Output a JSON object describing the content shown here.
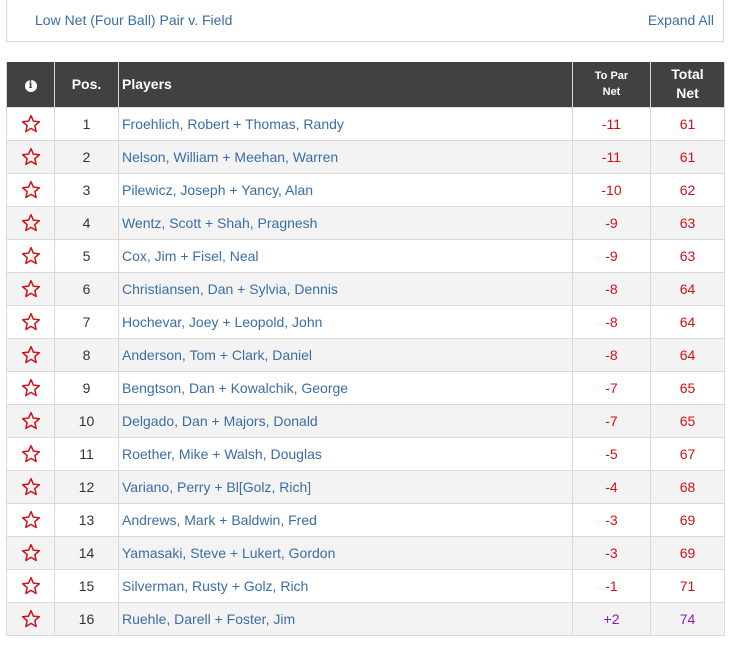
{
  "header": {
    "title": "Low Net (Four Ball) Pair v. Field",
    "expand_label": "Expand All"
  },
  "table": {
    "columns": {
      "info": "i",
      "pos": "Pos.",
      "players": "Players",
      "to_par_line1": "To Par",
      "to_par_line2": "Net",
      "total_line1": "Total",
      "total_line2": "Net"
    },
    "rows": [
      {
        "pos": "1",
        "players": "Froehlich, Robert + Thomas, Randy",
        "to_par": "-11",
        "net": "61"
      },
      {
        "pos": "2",
        "players": "Nelson, William + Meehan, Warren",
        "to_par": "-11",
        "net": "61"
      },
      {
        "pos": "3",
        "players": "Pilewicz, Joseph + Yancy, Alan",
        "to_par": "-10",
        "net": "62"
      },
      {
        "pos": "4",
        "players": "Wentz, Scott + Shah, Pragnesh",
        "to_par": "-9",
        "net": "63"
      },
      {
        "pos": "5",
        "players": "Cox, Jim + Fisel, Neal",
        "to_par": "-9",
        "net": "63"
      },
      {
        "pos": "6",
        "players": "Christiansen, Dan + Sylvia, Dennis",
        "to_par": "-8",
        "net": "64"
      },
      {
        "pos": "7",
        "players": "Hochevar, Joey + Leopold, John",
        "to_par": "-8",
        "net": "64"
      },
      {
        "pos": "8",
        "players": "Anderson, Tom + Clark, Daniel",
        "to_par": "-8",
        "net": "64"
      },
      {
        "pos": "9",
        "players": "Bengtson, Dan + Kowalchik, George",
        "to_par": "-7",
        "net": "65"
      },
      {
        "pos": "10",
        "players": "Delgado, Dan + Majors, Donald",
        "to_par": "-7",
        "net": "65"
      },
      {
        "pos": "11",
        "players": "Roether, Mike + Walsh, Douglas",
        "to_par": "-5",
        "net": "67"
      },
      {
        "pos": "12",
        "players": "Variano, Perry + Bl[Golz, Rich]",
        "to_par": "-4",
        "net": "68"
      },
      {
        "pos": "13",
        "players": "Andrews, Mark + Baldwin, Fred",
        "to_par": "-3",
        "net": "69"
      },
      {
        "pos": "14",
        "players": "Yamasaki, Steve + Lukert, Gordon",
        "to_par": "-3",
        "net": "69"
      },
      {
        "pos": "15",
        "players": "Silverman, Rusty + Golz, Rich",
        "to_par": "-1",
        "net": "71"
      },
      {
        "pos": "16",
        "players": "Ruehle, Darell + Foster, Jim",
        "to_par": "+2",
        "net": "74"
      }
    ]
  },
  "colors": {
    "link": "#3a6ea5",
    "under_par": "#d0121b",
    "over_par": "#8e1bb5",
    "star": "#d0121b",
    "header_bg": "#414042"
  },
  "icons": {
    "info": "info-icon",
    "favorite": "star-outline-icon"
  }
}
